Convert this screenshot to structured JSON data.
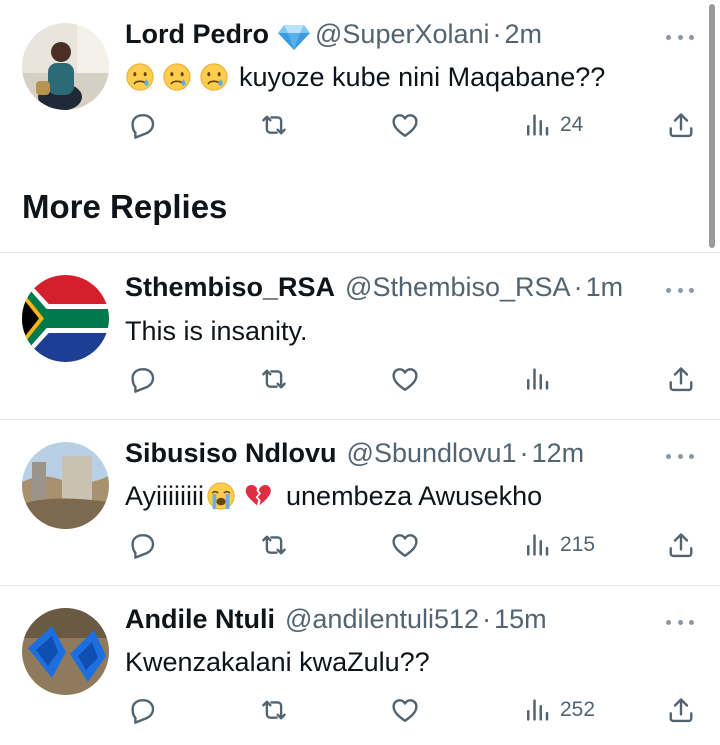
{
  "colors": {
    "text": "#0f1419",
    "secondary": "#536471",
    "divider": "#e6e9ec",
    "background": "#ffffff"
  },
  "section": {
    "title": "More Replies"
  },
  "tweets": [
    {
      "name": "Lord Pedro",
      "verified_icon": "gem-icon",
      "handle": "@SuperXolani",
      "sep": "·",
      "time": "2m",
      "emojis": [
        "crying-face",
        "crying-face",
        "crying-face"
      ],
      "text": "kuyoze kube nini Maqabane??",
      "views": "24"
    },
    {
      "name": "Sthembiso_RSA",
      "handle": "@Sthembiso_RSA",
      "sep": "·",
      "time": "1m",
      "text": "This is insanity.",
      "views": ""
    },
    {
      "name": "Sibusiso Ndlovu",
      "handle": "@Sbundlovu1",
      "sep": "·",
      "time": "12m",
      "text_prefix": "Ayiiiiiiii",
      "emojis": [
        "loudly-crying-face",
        "broken-heart"
      ],
      "text": "unembeza Awusekho",
      "views": "215"
    },
    {
      "name": "Andile Ntuli",
      "handle": "@andilentuli512",
      "sep": "·",
      "time": "15m",
      "text": "Kwenzakalani kwaZulu??",
      "views": "252"
    }
  ]
}
